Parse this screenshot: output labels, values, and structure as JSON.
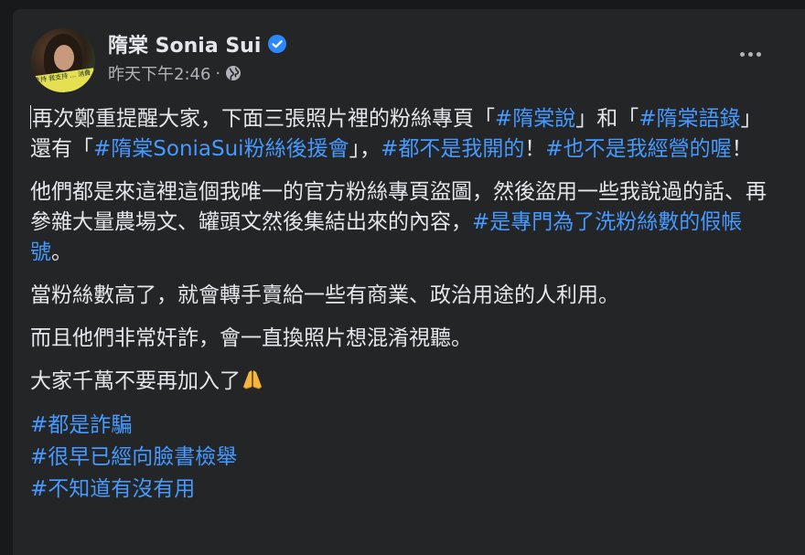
{
  "post": {
    "author": "隋棠 Sonia Sui",
    "timestamp": "昨天下午2:46",
    "separator": "·",
    "avatar_banner": "支持 我支持 ... 消費",
    "paragraphs": [
      [
        {
          "t": "再次鄭重提醒大家，下面三張照片裡的粉絲專頁「"
        },
        {
          "t": "#隋棠說",
          "tag": true
        },
        {
          "t": "」和「"
        },
        {
          "t": "#隋棠語錄",
          "tag": true
        },
        {
          "t": "」還有「"
        },
        {
          "t": "#隋棠SoniaSui粉絲後援會",
          "tag": true
        },
        {
          "t": "」，"
        },
        {
          "t": "#都不是我開的",
          "tag": true
        },
        {
          "t": "！"
        },
        {
          "t": "#也不是我經營的喔",
          "tag": true
        },
        {
          "t": "！"
        }
      ],
      [
        {
          "t": "他們都是來這裡這個我唯一的官方粉絲專頁盜圖，然後盜用一些我說過的話、再參雜大量農場文、罐頭文然後集結出來的內容，"
        },
        {
          "t": "#是專門為了洗粉絲數的假帳號",
          "tag": true
        },
        {
          "t": "。"
        }
      ],
      [
        {
          "t": "當粉絲數高了，就會轉手賣給一些有商業、政治用途的人利用。"
        }
      ],
      [
        {
          "t": "而且他們非常奸詐，會一直換照片想混淆視聽。"
        }
      ],
      [
        {
          "t": "大家千萬不要再加入了"
        }
      ]
    ],
    "hashtags": [
      "#都是詐騙",
      "#很早已經向臉書檢舉",
      "#不知道有沒有用"
    ]
  },
  "colors": {
    "background": "#18191a",
    "card": "#242526",
    "text": "#e4e6eb",
    "secondary": "#b0b3b8",
    "link": "#4599ff",
    "verified": "#2d88ff"
  },
  "icons": {
    "verified": "verified-badge-icon",
    "privacy": "globe-icon",
    "more": "more-options-icon",
    "emoji": "folded-hands-icon"
  }
}
